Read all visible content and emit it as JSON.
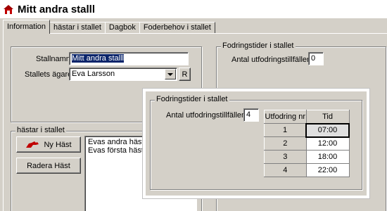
{
  "window": {
    "title": "Mitt andra stalll",
    "icon": "house-icon"
  },
  "tabs": [
    {
      "label": "Information",
      "active": true
    },
    {
      "label": "hästar i stallet",
      "active": false
    },
    {
      "label": "Dagbok",
      "active": false
    },
    {
      "label": "Foderbehov i stallet",
      "active": false
    }
  ],
  "stable": {
    "name_label": "Stallnamn",
    "name_value": "Mitt andra stalll",
    "owner_label": "Stallets ägare",
    "owner_value": "Eva Larsson",
    "r_button": "R"
  },
  "feeding_bg": {
    "group_label": "Fodringstider i stallet",
    "count_label": "Antal utfodringstillfällen",
    "count_value": "0"
  },
  "horses": {
    "group_label": "hästar i stallet",
    "new_button": "Ny Häst",
    "delete_button": "Radera Häst",
    "list": [
      "Evas andra häst",
      "Evas första häst"
    ]
  },
  "popup": {
    "group_label": "Fodringstider i stallet",
    "count_label": "Antal utfodringstillfällen",
    "count_value": "4",
    "table": {
      "headers": [
        "Utfodring nr",
        "Tid"
      ],
      "rows": [
        {
          "nr": "1",
          "time": "07:00"
        },
        {
          "nr": "2",
          "time": "12:00"
        },
        {
          "nr": "3",
          "time": "18:00"
        },
        {
          "nr": "4",
          "time": "22:00"
        }
      ]
    }
  },
  "colors": {
    "selection": "#0a246a",
    "face": "#d4d0c8",
    "accent_red": "#c00000"
  }
}
